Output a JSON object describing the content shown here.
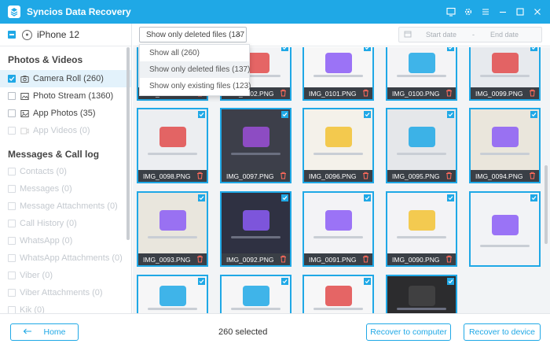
{
  "window": {
    "title": "Syncios Data Recovery",
    "brand_color": "#1fa8e6"
  },
  "sidebar": {
    "device": "iPhone 12",
    "sections": [
      {
        "title": "Photos & Videos",
        "items": [
          {
            "label": "Camera Roll (260)",
            "icon": "camera-icon",
            "state": "checked",
            "active": true
          },
          {
            "label": "Photo Stream (1360)",
            "icon": "cloud-photo-icon",
            "state": "unchecked",
            "active": false
          },
          {
            "label": "App Photos (35)",
            "icon": "image-icon",
            "state": "unchecked",
            "active": false
          },
          {
            "label": "App Videos (0)",
            "icon": "video-icon",
            "state": "disabled",
            "active": false
          }
        ]
      },
      {
        "title": "Messages & Call log",
        "items": [
          {
            "label": "Contacts (0)",
            "icon": "contacts-icon",
            "state": "disabled"
          },
          {
            "label": "Messages (0)",
            "icon": "message-icon",
            "state": "disabled"
          },
          {
            "label": "Message Attachments (0)",
            "icon": "attachment-icon",
            "state": "disabled"
          },
          {
            "label": "Call History (0)",
            "icon": "phone-icon",
            "state": "disabled"
          },
          {
            "label": "WhatsApp (0)",
            "icon": "whatsapp-icon",
            "state": "disabled"
          },
          {
            "label": "WhatsApp Attachments (0)",
            "icon": "attachment-icon",
            "state": "disabled"
          },
          {
            "label": "Viber (0)",
            "icon": "viber-icon",
            "state": "disabled"
          },
          {
            "label": "Viber Attachments (0)",
            "icon": "attachment-icon",
            "state": "disabled"
          },
          {
            "label": "Kik (0)",
            "icon": "kik-icon",
            "state": "disabled"
          }
        ]
      }
    ]
  },
  "toolbar": {
    "filter_value": "Show only deleted files (137",
    "start_date_placeholder": "Start date",
    "date_separator": "-",
    "end_date_placeholder": "End date"
  },
  "dropdown": {
    "options": [
      {
        "label": "Show all (260)",
        "selected": false
      },
      {
        "label": "Show only deleted files (137)",
        "selected": true
      },
      {
        "label": "Show only existing files (123)",
        "selected": false
      }
    ]
  },
  "grid": {
    "items": [
      {
        "name": "IMG_0103.PNG",
        "bg": "#f3f4f6",
        "accent": "#1fa8e6"
      },
      {
        "name": "IMG_0102.PNG",
        "bg": "#f3f4f6",
        "accent": "#e24b4b"
      },
      {
        "name": "IMG_0101.PNG",
        "bg": "#f7f7f7",
        "accent": "#8b5cf6"
      },
      {
        "name": "IMG_0100.PNG",
        "bg": "#f4f4f6",
        "accent": "#1fa8e6"
      },
      {
        "name": "IMG_0099.PNG",
        "bg": "#e7eaee",
        "accent": "#e24b4b"
      },
      {
        "name": "IMG_0098.PNG",
        "bg": "#eceef1",
        "accent": "#e24b4b"
      },
      {
        "name": "IMG_0097.PNG",
        "bg": "#3d3f4a",
        "accent": "#9b4fd8"
      },
      {
        "name": "IMG_0096.PNG",
        "bg": "#f4f1ea",
        "accent": "#f2c232"
      },
      {
        "name": "IMG_0095.PNG",
        "bg": "#e5e7ea",
        "accent": "#1fa8e6"
      },
      {
        "name": "IMG_0094.PNG",
        "bg": "#eae6dc",
        "accent": "#8b5cf6"
      },
      {
        "name": "IMG_0093.PNG",
        "bg": "#e9e6dd",
        "accent": "#8b5cf6"
      },
      {
        "name": "IMG_0092.PNG",
        "bg": "#2f3142",
        "accent": "#8b5cf6"
      },
      {
        "name": "IMG_0091.PNG",
        "bg": "#f3f3f6",
        "accent": "#8b5cf6"
      },
      {
        "name": "IMG_0090.PNG",
        "bg": "#f3f3f6",
        "accent": "#f2c232"
      },
      {
        "name": "",
        "bg": "#f2f3f6",
        "accent": "#8b5cf6"
      },
      {
        "name": "",
        "bg": "#f6f6f7",
        "accent": "#1fa8e6"
      },
      {
        "name": "",
        "bg": "#f6f6f7",
        "accent": "#1fa8e6"
      },
      {
        "name": "",
        "bg": "#f7f7f8",
        "accent": "#e24b4b"
      },
      {
        "name": "",
        "bg": "#2c2c2e",
        "accent": "#444"
      }
    ]
  },
  "footer": {
    "home_label": "Home",
    "selected_text": "260 selected",
    "recover_computer_label": "Recover to computer",
    "recover_device_label": "Recover to device"
  }
}
